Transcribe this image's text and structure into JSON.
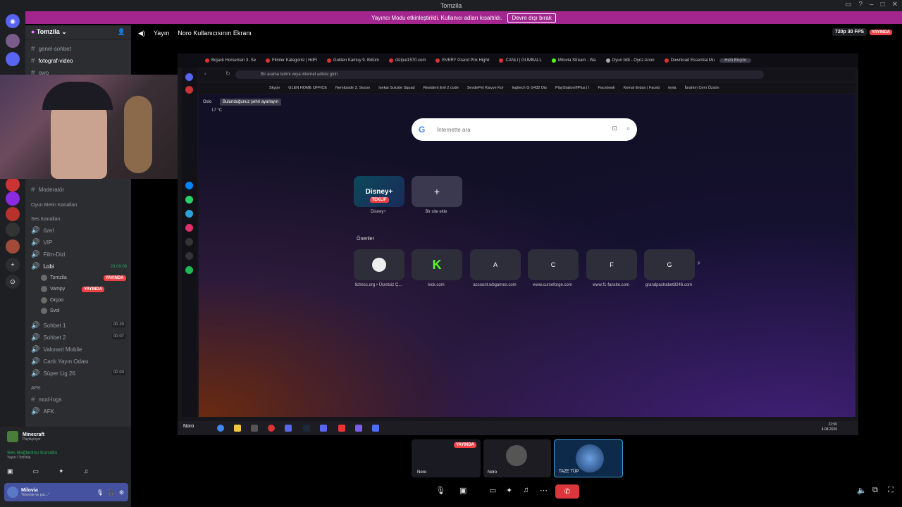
{
  "window": {
    "title": "Tomzila"
  },
  "banner": {
    "text": "Yayıncı Modu etkinleştirildi. Kullanıcı adları kısaltıldı.",
    "button": "Devre dışı bırak"
  },
  "guild": {
    "name": "Tomzila"
  },
  "channels": {
    "top": [
      "genel-sohbet",
      "fotograf-video",
      "owo"
    ],
    "moderator": "Moderatör",
    "cat_text": "Oyun Metin Kanalları",
    "cat_voice": "Ses Kanalları",
    "voice": [
      "özel",
      "VIP",
      "Film-Dizi",
      "Lobi"
    ],
    "lobi_time": "29:09:08",
    "lobi_users": [
      "Tomzila",
      "Vampy",
      "Orçoo",
      "Svol"
    ],
    "live": "YAYINDA",
    "more": [
      "Sohbet 1",
      "Sohbet 2",
      "Valorant Mobile",
      "Canlı Yayın Odası",
      "Süper Lig 26"
    ],
    "counts": [
      "00",
      "20",
      "00",
      "07",
      "00",
      "03"
    ],
    "cat_afk": "AFK",
    "afk": [
      "mod-logs",
      "AFK"
    ]
  },
  "voicepanel": {
    "activity": "Minecraft",
    "activity_sub": "Paylaşılıyor",
    "conn": "Ses Bağlantısı Kuruldu",
    "conn_sub": "Yayın / Tomzila",
    "user": "Milovia",
    "user_status": "\"Ebonite ve pur...\""
  },
  "topbar": {
    "stream": "Yayın",
    "screen": "Noro Kullanıcısının Ekranı",
    "quality": "720p 30 FPS",
    "live": "YAYINDA"
  },
  "browser": {
    "tabs": [
      "Bojack Horseman 3. Se",
      "Filmler Kategorisi | HdFi",
      "Golden Kamuy 9. Bölüm",
      "dizipal1570.com",
      "EVERY Grand Prix Highli",
      "CANLI | GUMBALL",
      "Milovia Stream - Wa",
      "Oyun bitti - Oynz Anon",
      "Download Essential Mu",
      "Hızlı Erişim"
    ],
    "url_placeholder": "Bir arama terimi veya internet adresi girin",
    "bookmarks": [
      "Skype",
      "GLEN HOME OFFICE",
      "Nemlizade 3. Sezon",
      "Isekai Suicide Squad",
      "Resident Evil 2 code",
      "SevdePet Klavye Kor",
      "logitech G G432 Dis",
      "PlayStation®Plus | I",
      "Facebook",
      "Kemal Erdan | Faceb",
      "leyla",
      "İbrahim Cem Özsön"
    ],
    "city": "Oslo",
    "city_hint": "Bulunduğunuz şehri ayarlayın",
    "temp": "17 °C",
    "search_placeholder": "İnternette ara",
    "speeddial": [
      {
        "label": "Disney+",
        "tag": "TEKLİF"
      },
      {
        "label": "Bir site ekle",
        "tag": "+"
      }
    ],
    "suggest_title": "Öneriler",
    "suggest": [
      {
        "letter": "",
        "label": "lichess.org • Ücretsiz Ç..."
      },
      {
        "letter": "K",
        "label": "kick.com"
      },
      {
        "letter": "A",
        "label": "account.wbgames.com"
      },
      {
        "letter": "C",
        "label": "www.curseforge.com"
      },
      {
        "letter": "F",
        "label": "www.f1-fansite.com"
      },
      {
        "letter": "G",
        "label": "grandpashabet8246.com"
      }
    ],
    "taskbar_user": "Noro",
    "clock": "22:50",
    "date": "4.08.2026"
  },
  "participants": [
    {
      "name": "Noro",
      "live": "YAYINDA"
    },
    {
      "name": "Noro"
    },
    {
      "name": "TAZE TÜP"
    }
  ]
}
